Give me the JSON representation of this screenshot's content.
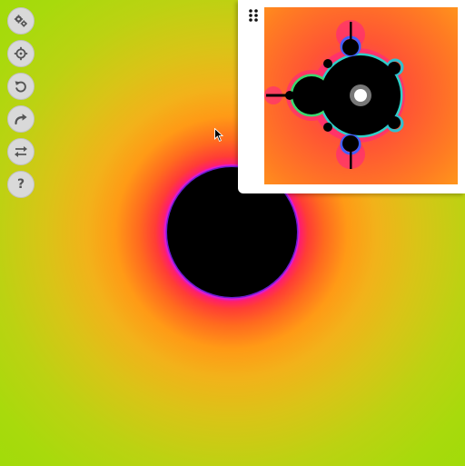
{
  "toolbar": {
    "buttons": [
      {
        "name": "settings",
        "icon": "gears-icon"
      },
      {
        "name": "recenter",
        "icon": "crosshair-icon"
      },
      {
        "name": "undo",
        "icon": "undo-icon"
      },
      {
        "name": "redo",
        "icon": "redo-icon"
      },
      {
        "name": "swap",
        "icon": "swap-arrows-icon"
      },
      {
        "name": "help",
        "icon": "question-icon",
        "label": "?"
      }
    ]
  },
  "minimap": {
    "handle_icon": "drag-dots-icon",
    "viewport_marker_icon": "viewport-ring-icon"
  },
  "colors": {
    "background_far": "#96dc06",
    "background_near": "#ff6a1f",
    "set_interior": "#000000",
    "set_edge": "#e01bd2",
    "button_fill": "#d9d9d9",
    "button_icon": "#555555",
    "panel": "#ffffff"
  }
}
